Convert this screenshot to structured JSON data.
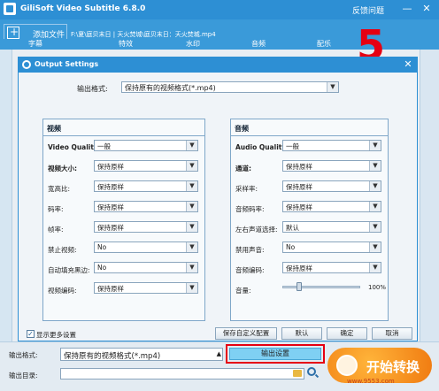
{
  "app": {
    "title": "GiliSoft Video Subtitle 6.8.0",
    "feedback": "反馈问题",
    "minimize": "—",
    "close": "✕",
    "add_file": "添加文件",
    "file_path": "F:\\夏\\庭贝末日 | 天火焚城\\庭贝末日：天火焚城.mp4",
    "tabs": [
      "字幕",
      "特效",
      "水印",
      "音频",
      "配乐"
    ],
    "step_number": "5",
    "accent_color": "#2d8fd4"
  },
  "dialog": {
    "title": "Output Settings",
    "close": "✕",
    "format_label": "输出格式:",
    "format_value": "保持原有的视频格式(*.mp4)",
    "video": {
      "title": "视频",
      "rows": [
        {
          "label": "Video Quality:",
          "value": "一般"
        },
        {
          "label": "视频大小:",
          "value": "保持原样"
        },
        {
          "label": "宽高比:",
          "value": "保持原样"
        },
        {
          "label": "码率:",
          "value": "保持原样"
        },
        {
          "label": "帧率:",
          "value": "保持原样"
        },
        {
          "label": "禁止视频:",
          "value": "No"
        },
        {
          "label": "自动填充黑边:",
          "value": "No"
        },
        {
          "label": "视频编码:",
          "value": "保持原样"
        }
      ]
    },
    "audio": {
      "title": "音频",
      "rows": [
        {
          "label": "Audio Quality:",
          "value": "一般"
        },
        {
          "label": "通道:",
          "value": "保持原样"
        },
        {
          "label": "采样率:",
          "value": "保持原样"
        },
        {
          "label": "音频码率:",
          "value": "保持原样"
        },
        {
          "label": "左右声道选择:",
          "value": "默认"
        },
        {
          "label": "禁用声音:",
          "value": "No"
        },
        {
          "label": "音频编码:",
          "value": "保持原样"
        }
      ],
      "volume_label": "音量:",
      "volume_value": "100%",
      "volume_level": 0.2
    },
    "show_more": "显示更多设置",
    "buttons": {
      "save_custom": "保存自定义配置",
      "default": "默认",
      "ok": "确定",
      "cancel": "取消"
    }
  },
  "bottom": {
    "format_label": "输出格式:",
    "format_value": "保持原有的视频格式(*.mp4)",
    "export_settings": "输出设置",
    "dir_label": "输出目录:",
    "dir_value": "",
    "convert": "开始转换",
    "watermark": "www.9553.com"
  }
}
